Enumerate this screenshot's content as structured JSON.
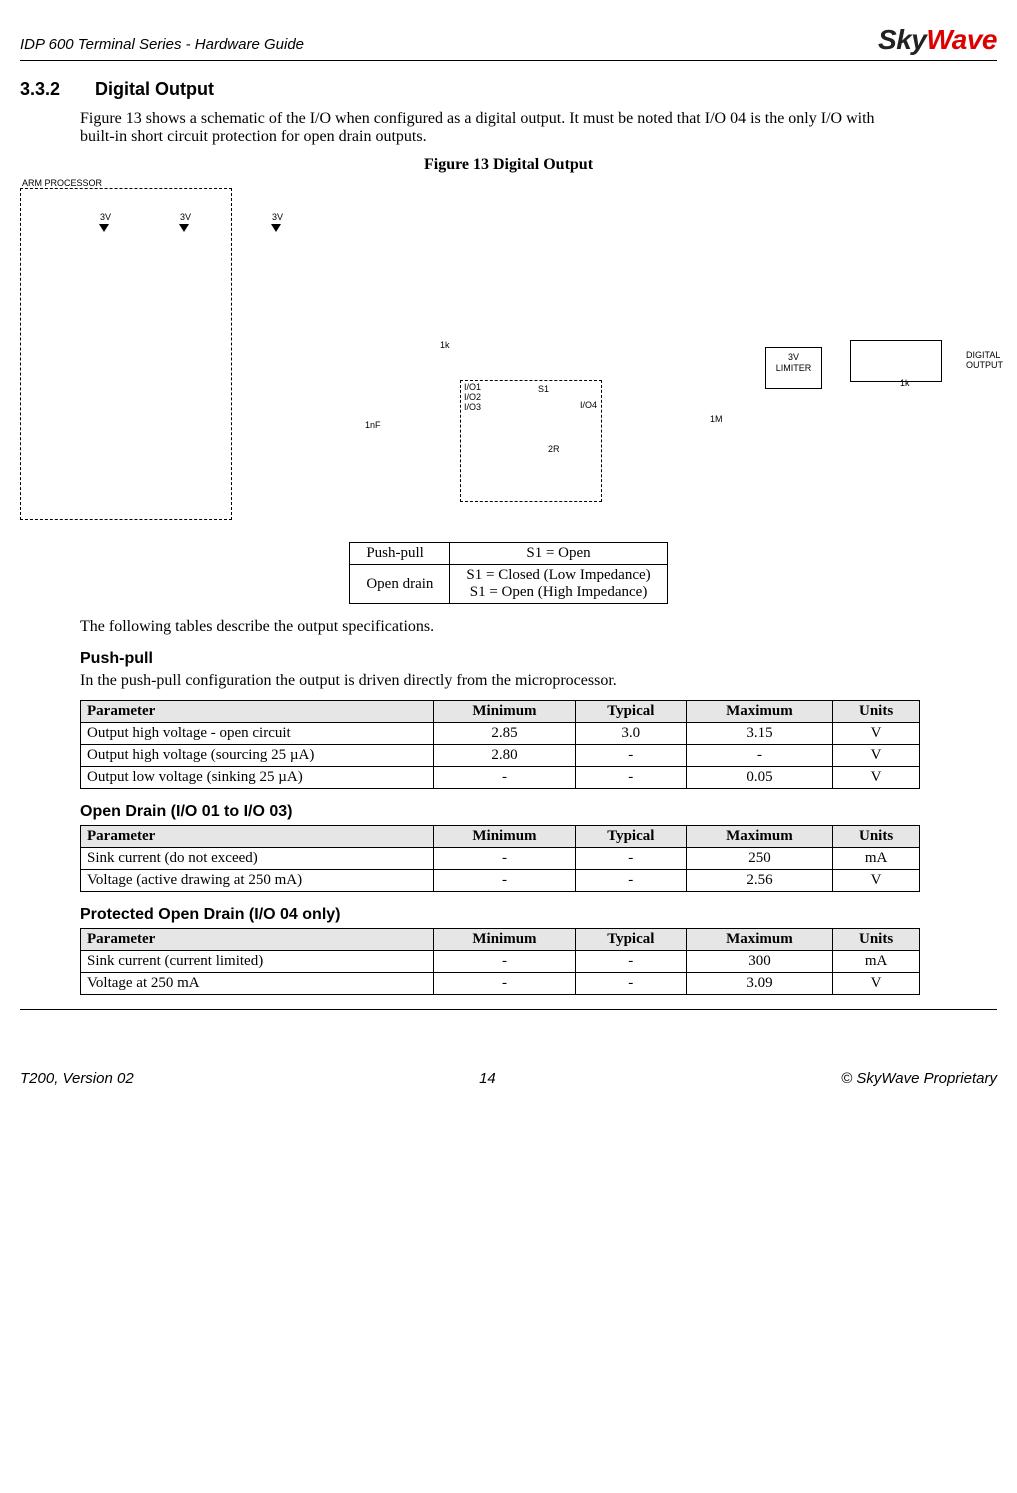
{
  "header": {
    "doc_title": "IDP 600 Terminal Series - Hardware Guide",
    "logo_part1": "Sky",
    "logo_part2": "Wave"
  },
  "section": {
    "number": "3.3.2",
    "title": "Digital Output",
    "intro": "Figure 13 shows a schematic of the I/O when configured as a digital output. It must be noted that I/O 04 is the only I/O with built-in short circuit protection for open drain outputs.",
    "figure_label": "Figure 13   Digital Output"
  },
  "figure_labels": {
    "arm_processor": "ARM PROCESSOR",
    "v3_a": "3V",
    "v3_b": "3V",
    "v3_c": "3V",
    "r_1k_a": "1k",
    "r_1k_b": "1k",
    "c_1nf": "1nF",
    "io1": "I/O1",
    "io2": "I/O2",
    "io3": "I/O3",
    "io4": "I/O4",
    "s1": "S1",
    "r_2r": "2R",
    "r_1m": "1M",
    "limiter_l1": "3V",
    "limiter_l2": "LIMITER",
    "digital_out_l1": "DIGITAL",
    "digital_out_l2": "OUTPUT"
  },
  "mode_table": {
    "rows": [
      {
        "mode": "Push-pull",
        "state": "S1 = Open"
      },
      {
        "mode": "Open drain",
        "state": "S1 = Closed (Low Impedance)\nS1 = Open (High Impedance)"
      }
    ]
  },
  "tables_intro": "The following tables describe the output specifications.",
  "pushpull": {
    "heading": "Push-pull",
    "desc": "In the push-pull configuration the output is driven directly from the microprocessor.",
    "cols": {
      "parameter": "Parameter",
      "min": "Minimum",
      "typ": "Typical",
      "max": "Maximum",
      "units": "Units"
    },
    "rows": [
      {
        "p": "Output high voltage - open circuit",
        "min": "2.85",
        "typ": "3.0",
        "max": "3.15",
        "u": "V"
      },
      {
        "p": "Output high voltage (sourcing 25 µA)",
        "min": "2.80",
        "typ": "-",
        "max": "-",
        "u": "V"
      },
      {
        "p": "Output low voltage (sinking 25 µA)",
        "min": "-",
        "typ": "-",
        "max": "0.05",
        "u": "V"
      }
    ]
  },
  "opendrain": {
    "heading": "Open Drain (I/O 01 to I/O 03)",
    "rows": [
      {
        "p": "Sink current (do not exceed)",
        "min": "-",
        "typ": "-",
        "max": "250",
        "u": "mA"
      },
      {
        "p": "Voltage (active drawing at 250 mA)",
        "min": "-",
        "typ": "-",
        "max": "2.56",
        "u": "V"
      }
    ]
  },
  "protected": {
    "heading": "Protected Open Drain (I/O 04 only)",
    "rows": [
      {
        "p": "Sink current (current limited)",
        "min": "-",
        "typ": "-",
        "max": "300",
        "u": "mA"
      },
      {
        "p": "Voltage at 250 mA",
        "min": "-",
        "typ": "-",
        "max": "3.09",
        "u": "V"
      }
    ]
  },
  "footer": {
    "left": "T200, Version 02",
    "center": "14",
    "right": "© SkyWave Proprietary"
  }
}
